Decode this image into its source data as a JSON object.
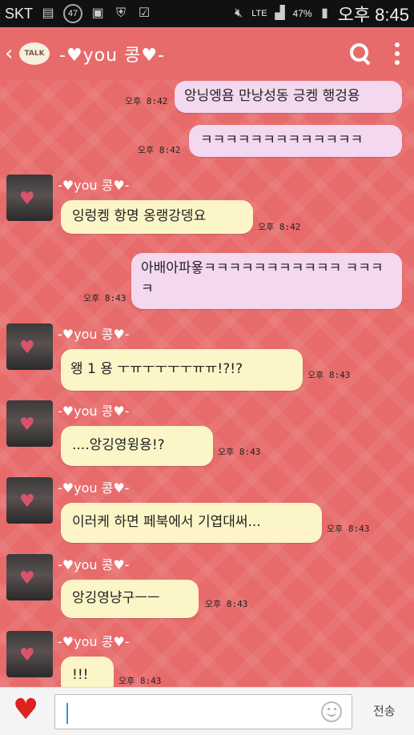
{
  "status_bar": {
    "carrier": "SKT",
    "badge_count": "47",
    "network": "LTE",
    "battery": "47%",
    "time": "오후 8:45"
  },
  "header": {
    "talk_label": "TALK",
    "title": "-♥you 콩♥-"
  },
  "messages": [
    {
      "side": "out",
      "text": "앙닝엥욤 만낭성동 긍켕 행겅용",
      "time": "오후 8:42"
    },
    {
      "side": "out",
      "text": "ㅋㅋㅋㅋㅋㅋㅋㅋㅋㅋㅋㅋㅋ",
      "time": "오후 8:42"
    },
    {
      "side": "in",
      "sender": "-♥you 콩♥-",
      "text": "잉렁켕 항명 옹랭강뎅요",
      "time": "오후 8:42"
    },
    {
      "side": "out",
      "text": "아배아파욯ㅋㅋㅋㅋㅋㅋㅋㅋㅋㅋㅋ ㅋㅋㅋㅋ",
      "time": "오후 8:43"
    },
    {
      "side": "in",
      "sender": "-♥you 콩♥-",
      "text": "왱 1 용 ㅜㅠㅜㅜㅜㅜㅠㅠ!?!?",
      "time": "오후 8:43"
    },
    {
      "side": "in",
      "sender": "-♥you 콩♥-",
      "text": "....앙깅영윙용!?",
      "time": "오후 8:43"
    },
    {
      "side": "in",
      "sender": "-♥you 콩♥-",
      "text": "이러케 하면 페북에서 기엽대써...",
      "time": "오후 8:43"
    },
    {
      "side": "in",
      "sender": "-♥you 콩♥-",
      "text": "앙깅영냥구ㅡㅡ",
      "time": "오후 8:43"
    },
    {
      "side": "in",
      "sender": "-♥you 콩♥-",
      "text": "!!!",
      "time": "오후 8:43"
    }
  ],
  "input": {
    "value": "",
    "send_label": "전송"
  },
  "colors": {
    "background": "#e86b6b",
    "outgoing_bubble": "#f3d8ef",
    "incoming_bubble": "#fbf5c8"
  }
}
